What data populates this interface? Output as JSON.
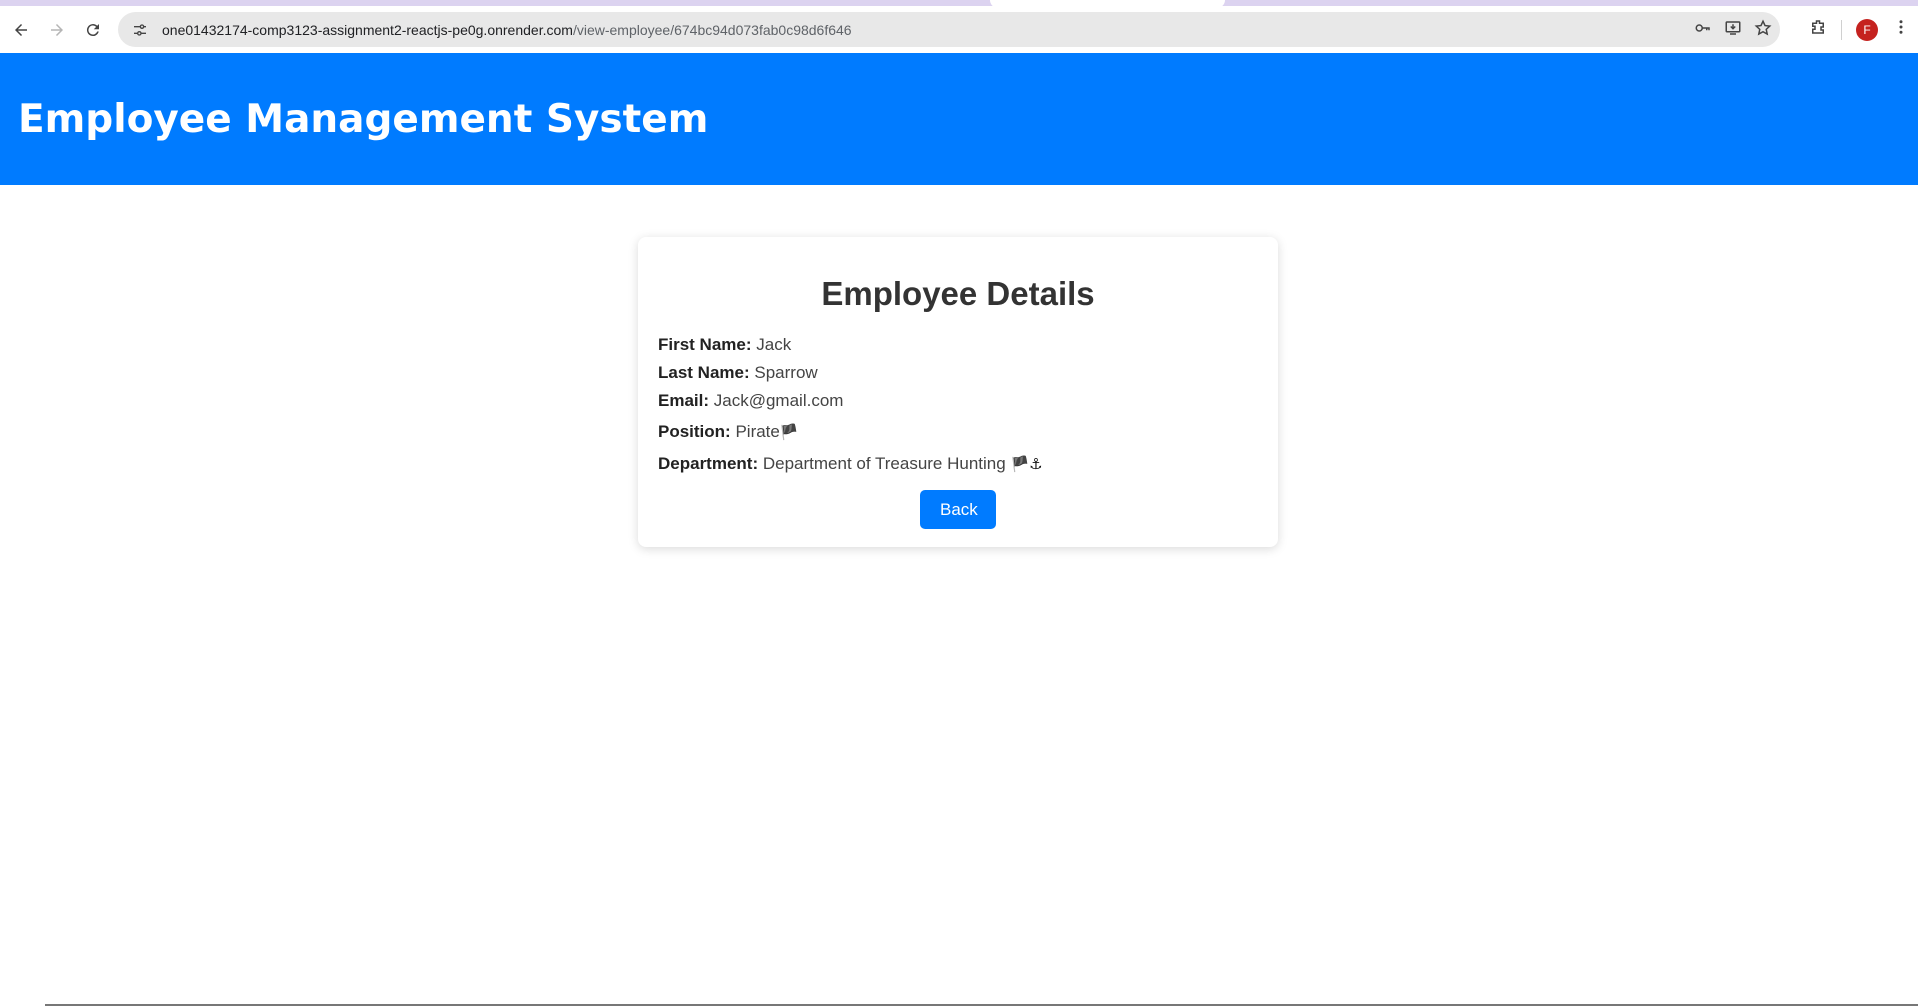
{
  "browser": {
    "url_host": "one01432174-comp3123-assignment2-reactjs-pe0g.onrender.com",
    "url_path": "/view-employee/674bc94d073fab0c98d6f646",
    "profile_initial": "F"
  },
  "header": {
    "title": "Employee Management System"
  },
  "card": {
    "title": "Employee Details",
    "fields": [
      {
        "label": "First Name:",
        "value": "Jack"
      },
      {
        "label": "Last Name:",
        "value": "Sparrow"
      },
      {
        "label": "Email:",
        "value": "Jack@gmail.com"
      },
      {
        "label": "Position:",
        "value": "Pirate",
        "emoji": "🏴"
      },
      {
        "label": "Department:",
        "value": "Department of Treasure Hunting",
        "emoji": "🏴⚓"
      }
    ],
    "back_label": "Back"
  },
  "colors": {
    "header_bg": "#007bff",
    "button_bg": "#007bff"
  }
}
